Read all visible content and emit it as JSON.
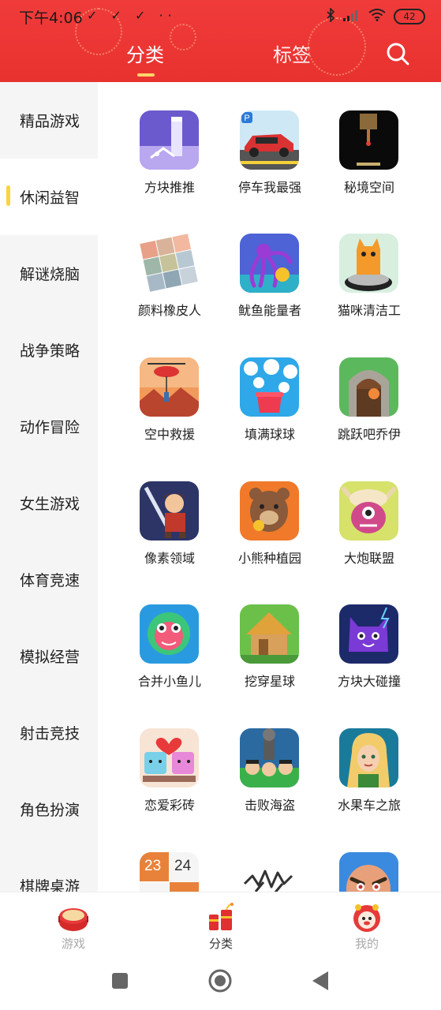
{
  "status": {
    "time": "下午4:06",
    "left_icons": "✓ ✓ ✓ ··",
    "battery": "42"
  },
  "header": {
    "tabs": [
      {
        "label": "分类",
        "active": true
      },
      {
        "label": "标签",
        "active": false
      }
    ],
    "search_icon": "search-icon"
  },
  "sidebar": {
    "items": [
      {
        "label": "精品游戏"
      },
      {
        "label": "休闲益智",
        "active": true
      },
      {
        "label": "解谜烧脑"
      },
      {
        "label": "战争策略"
      },
      {
        "label": "动作冒险"
      },
      {
        "label": "女生游戏"
      },
      {
        "label": "体育竞速"
      },
      {
        "label": "模拟经营"
      },
      {
        "label": "射击竞技"
      },
      {
        "label": "角色扮演"
      },
      {
        "label": "棋牌桌游"
      }
    ]
  },
  "games": [
    {
      "name": "方块推推"
    },
    {
      "name": "停车我最强"
    },
    {
      "name": "秘境空间"
    },
    {
      "name": "颜料橡皮人"
    },
    {
      "name": "鱿鱼能量者"
    },
    {
      "name": "猫咪清洁工"
    },
    {
      "name": "空中救援"
    },
    {
      "name": "填满球球"
    },
    {
      "name": "跳跃吧乔伊"
    },
    {
      "name": "像素领域"
    },
    {
      "name": "小熊种植园"
    },
    {
      "name": "大炮联盟"
    },
    {
      "name": "合并小鱼儿"
    },
    {
      "name": "挖穿星球"
    },
    {
      "name": "方块大碰撞"
    },
    {
      "name": "恋爱彩砖"
    },
    {
      "name": "击败海盗"
    },
    {
      "name": "水果车之旅"
    },
    {
      "name": ""
    },
    {
      "name": ""
    },
    {
      "name": ""
    }
  ],
  "partial_icon_text": {
    "a": "23",
    "b": "24"
  },
  "bottom_nav": [
    {
      "label": "游戏",
      "icon": "drum-icon"
    },
    {
      "label": "分类",
      "icon": "firecracker-icon",
      "active": true
    },
    {
      "label": "我的",
      "icon": "lion-icon"
    }
  ],
  "colors": {
    "header_red": "#e8322f",
    "active_indicator": "#ffd23f",
    "sidebar_bg": "#f5f5f5"
  }
}
